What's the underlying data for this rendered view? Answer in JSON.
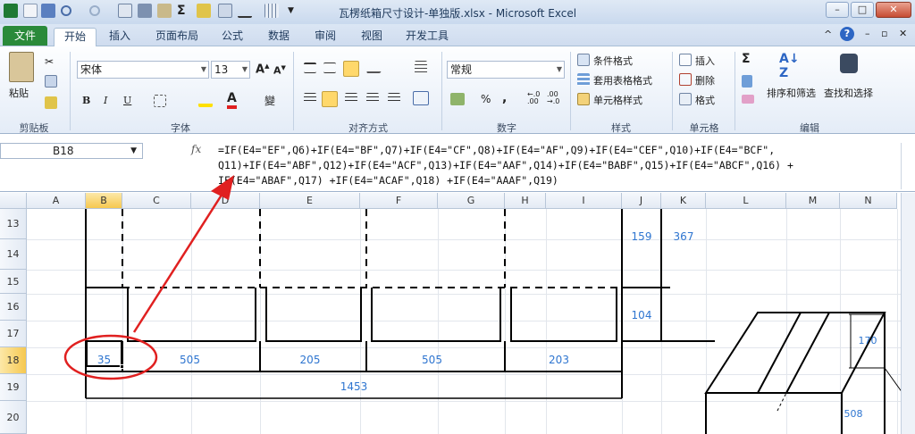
{
  "window": {
    "title": "瓦楞纸箱尺寸设计-单独版.xlsx - Microsoft Excel",
    "min_label": "–",
    "max_label": "□",
    "close_label": "✕"
  },
  "tabs": {
    "file": "文件",
    "items": [
      "开始",
      "插入",
      "页面布局",
      "公式",
      "数据",
      "审阅",
      "视图",
      "开发工具"
    ],
    "active": "开始"
  },
  "ribbon": {
    "clipboard": {
      "label": "剪贴板",
      "paste": "粘贴"
    },
    "font": {
      "label": "字体",
      "name": "宋体",
      "size": "13",
      "bold": "B",
      "italic": "I",
      "underline": "U"
    },
    "alignment": {
      "label": "对齐方式"
    },
    "number": {
      "label": "数字",
      "format": "常规",
      "percent": "%",
      "comma": ","
    },
    "styles": {
      "label": "样式",
      "conditional": "条件格式",
      "table": "套用表格格式",
      "cell_styles": "单元格样式"
    },
    "cells": {
      "label": "单元格",
      "insert": "插入",
      "delete": "删除",
      "format": "格式"
    },
    "editing": {
      "label": "编辑",
      "sort_filter": "排序和筛选",
      "find_select": "查找和选择"
    }
  },
  "formula_bar": {
    "name_box": "B18",
    "fx": "fx",
    "line1": "=IF(E4=\"EF\",Q6)+IF(E4=\"BF\",Q7)+IF(E4=\"CF\",Q8)+IF(E4=\"AF\",Q9)+IF(E4=\"CEF\",Q10)+IF(E4=\"BCF\",",
    "line2": "Q11)+IF(E4=\"ABF\",Q12)+IF(E4=\"ACF\",Q13)+IF(E4=\"AAF\",Q14)+IF(E4=\"BABF\",Q15)+IF(E4=\"ABCF\",Q16) +",
    "line3": "IF(E4=\"ABAF\",Q17) +IF(E4=\"ACAF\",Q18) +IF(E4=\"AAAF\",Q19)"
  },
  "sheet": {
    "columns": [
      "A",
      "B",
      "C",
      "D",
      "E",
      "F",
      "G",
      "H",
      "I",
      "J",
      "K",
      "L",
      "M",
      "N"
    ],
    "selected_column": "B",
    "rows": [
      "13",
      "14",
      "15",
      "16",
      "17",
      "18",
      "19",
      "20"
    ],
    "selected_row": "18",
    "values": {
      "b18": "35",
      "d18": "505",
      "e18": "205",
      "g18": "505",
      "i18": "203",
      "total": "1453",
      "j13": "159",
      "k13": "367",
      "j16": "104",
      "box_height": "170",
      "box_length": "508"
    }
  },
  "colors": {
    "file_tab": "#2a8a3a",
    "number_text": "#2e75d0",
    "annotation": "#e02020",
    "selection_header": "#f6c850"
  }
}
